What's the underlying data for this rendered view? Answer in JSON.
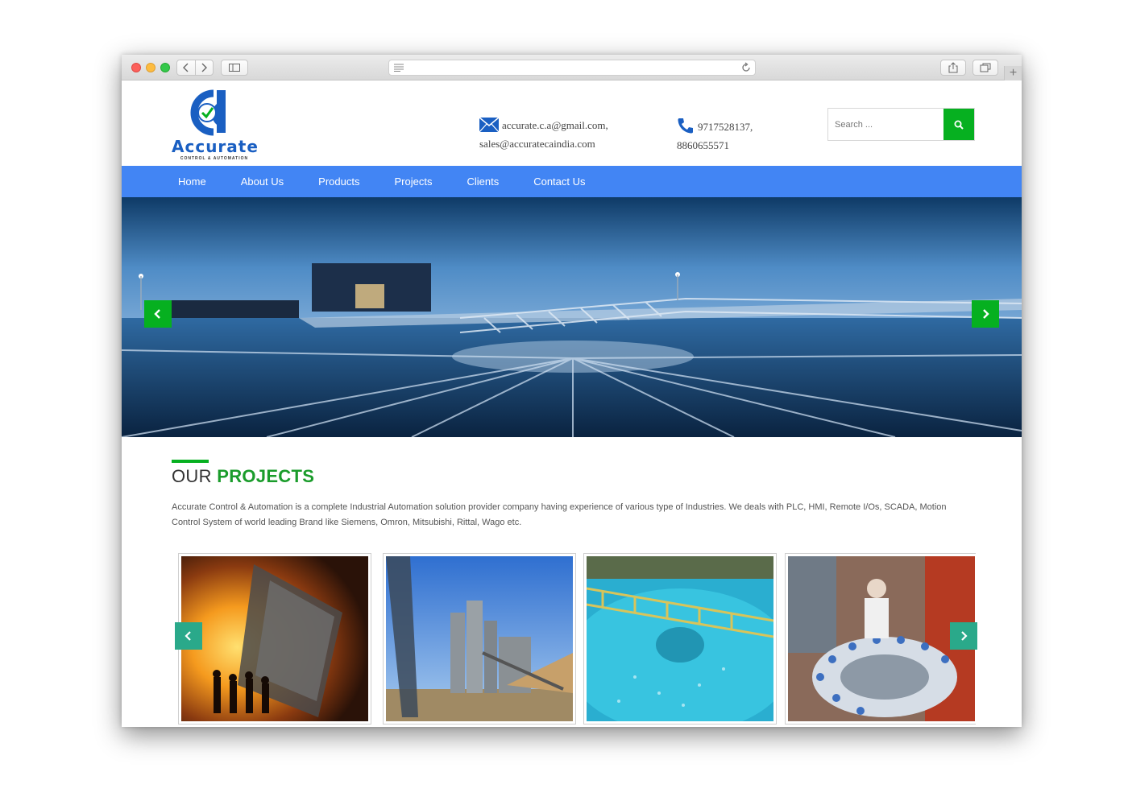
{
  "browser": {
    "address": ""
  },
  "header": {
    "logo": {
      "name": "Accurate",
      "tagline": "CONTROL & AUTOMATION"
    },
    "email_line1": "accurate.c.a@gmail.com,",
    "email_line2": "sales@accuratecaindia.com",
    "phone_line1": "9717528137,",
    "phone_line2": "8860655571",
    "search_placeholder": "Search ..."
  },
  "nav": {
    "items": [
      {
        "label": "Home"
      },
      {
        "label": "About Us"
      },
      {
        "label": "Products"
      },
      {
        "label": "Projects"
      },
      {
        "label": "Clients"
      },
      {
        "label": "Contact Us"
      }
    ]
  },
  "projects": {
    "title_light": "OUR",
    "title_bold": "PROJECTS",
    "description": "Accurate Control & Automation is a complete Industrial Automation solution provider company having experience of various type of Industries. We deals with PLC, HMI, Remote I/Os, SCADA, Motion Control System of world leading Brand like Siemens, Omron, Mitsubishi, Rittal, Wago etc."
  },
  "colors": {
    "nav_bg": "#4285f4",
    "accent_green": "#06b020",
    "title_green": "#1a9c2b",
    "teal_arrow": "#2aa98a"
  },
  "icons": {
    "email": "envelope-icon",
    "phone": "phone-icon",
    "search": "search-icon",
    "slider_prev": "chevron-left-icon",
    "slider_next": "chevron-right-icon"
  }
}
